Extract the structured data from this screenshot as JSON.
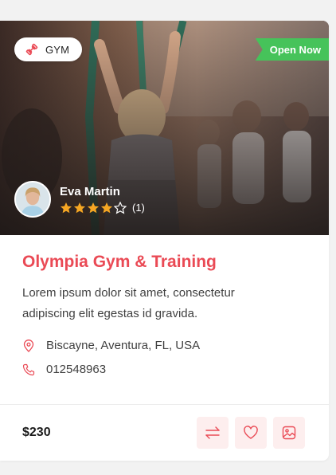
{
  "listing": {
    "category": "GYM",
    "category_icon": "dumbbell-icon",
    "status": "Open Now",
    "author": {
      "name": "Eva Martin",
      "rating": 4,
      "rating_max": 5,
      "rating_count": "(1)"
    },
    "title": "Olympia Gym & Training",
    "description": "Lorem ipsum dolor sit amet, consectetur adipiscing elit egestas id gravida.",
    "address": "Biscayne, Aventura, FL, USA",
    "phone": "012548963",
    "price": "$230"
  },
  "actions": [
    {
      "name": "compare",
      "icon": "compare-arrows-icon"
    },
    {
      "name": "favorite",
      "icon": "heart-icon"
    },
    {
      "name": "gallery",
      "icon": "gallery-icon"
    }
  ],
  "colors": {
    "accent": "#ea4a55",
    "accent_soft": "#fdeeee",
    "status": "#46c35a",
    "star": "#f5a623"
  }
}
